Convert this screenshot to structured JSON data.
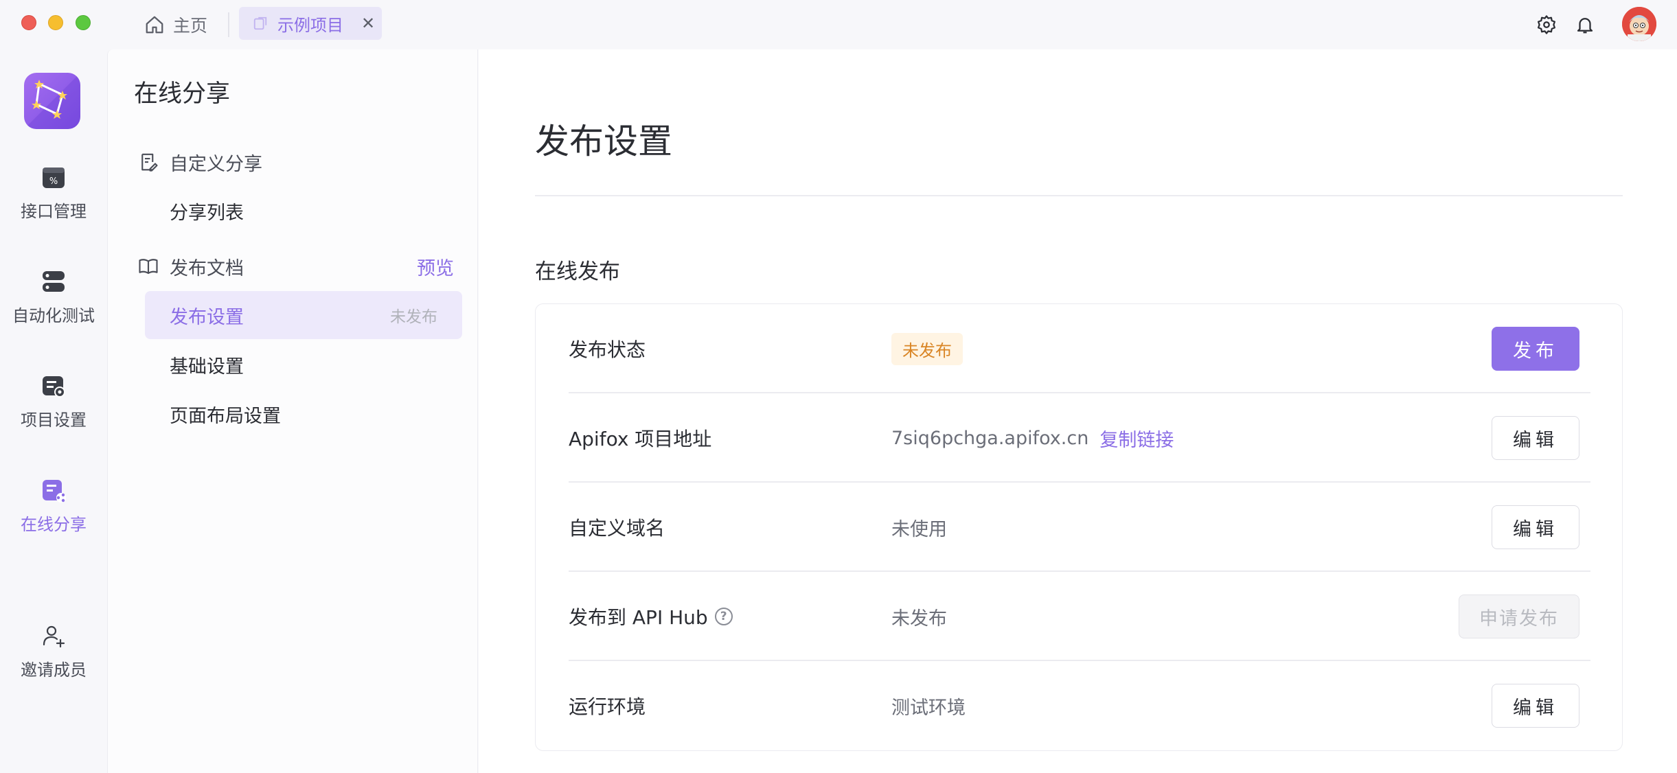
{
  "titlebar": {
    "home_tab": "主页",
    "project_tab": "示例项目",
    "close_glyph": "✕"
  },
  "rail": {
    "items": [
      {
        "label": "接口管理",
        "icon": "api-icon"
      },
      {
        "label": "自动化测试",
        "icon": "automation-icon"
      },
      {
        "label": "项目设置",
        "icon": "project-settings-icon"
      },
      {
        "label": "在线分享",
        "icon": "share-icon"
      },
      {
        "label": "邀请成员",
        "icon": "add-user-icon"
      }
    ],
    "active_color": "#8b6ee6"
  },
  "sidebar": {
    "title": "在线分享",
    "group_custom_share": "自定义分享",
    "share_list": "分享列表",
    "group_publish_docs": "发布文档",
    "preview": "预览",
    "publish_settings": "发布设置",
    "publish_settings_badge": "未发布",
    "basic_settings": "基础设置",
    "page_layout_settings": "页面布局设置"
  },
  "main": {
    "page_title": "发布设置",
    "section_title": "在线发布",
    "rows": {
      "status": {
        "label": "发布状态",
        "value": "未发布",
        "button": "发布"
      },
      "address": {
        "label": "Apifox 项目地址",
        "value": "7siq6pchga.apifox.cn",
        "link": "复制链接",
        "button": "编辑"
      },
      "domain": {
        "label": "自定义域名",
        "value": "未使用",
        "button": "编辑"
      },
      "apihub": {
        "label": "发布到 API Hub",
        "help": "?",
        "value": "未发布",
        "button": "申请发布"
      },
      "env": {
        "label": "运行环境",
        "value": "测试环境",
        "button": "编辑"
      }
    }
  },
  "colors": {
    "accent": "#8e70e8",
    "warning_bg": "#fff4e3",
    "warning_text": "#d98525"
  }
}
